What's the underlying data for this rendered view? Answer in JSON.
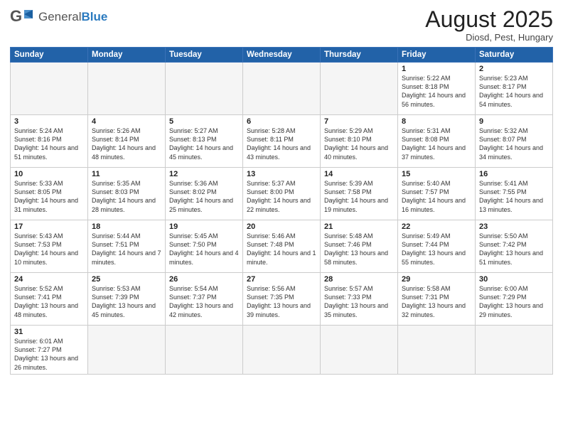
{
  "header": {
    "logo_general": "General",
    "logo_blue": "Blue",
    "month_title": "August 2025",
    "location": "Diosd, Pest, Hungary"
  },
  "weekdays": [
    "Sunday",
    "Monday",
    "Tuesday",
    "Wednesday",
    "Thursday",
    "Friday",
    "Saturday"
  ],
  "weeks": [
    [
      {
        "day": "",
        "info": ""
      },
      {
        "day": "",
        "info": ""
      },
      {
        "day": "",
        "info": ""
      },
      {
        "day": "",
        "info": ""
      },
      {
        "day": "",
        "info": ""
      },
      {
        "day": "1",
        "info": "Sunrise: 5:22 AM\nSunset: 8:18 PM\nDaylight: 14 hours and 56 minutes."
      },
      {
        "day": "2",
        "info": "Sunrise: 5:23 AM\nSunset: 8:17 PM\nDaylight: 14 hours and 54 minutes."
      }
    ],
    [
      {
        "day": "3",
        "info": "Sunrise: 5:24 AM\nSunset: 8:16 PM\nDaylight: 14 hours and 51 minutes."
      },
      {
        "day": "4",
        "info": "Sunrise: 5:26 AM\nSunset: 8:14 PM\nDaylight: 14 hours and 48 minutes."
      },
      {
        "day": "5",
        "info": "Sunrise: 5:27 AM\nSunset: 8:13 PM\nDaylight: 14 hours and 45 minutes."
      },
      {
        "day": "6",
        "info": "Sunrise: 5:28 AM\nSunset: 8:11 PM\nDaylight: 14 hours and 43 minutes."
      },
      {
        "day": "7",
        "info": "Sunrise: 5:29 AM\nSunset: 8:10 PM\nDaylight: 14 hours and 40 minutes."
      },
      {
        "day": "8",
        "info": "Sunrise: 5:31 AM\nSunset: 8:08 PM\nDaylight: 14 hours and 37 minutes."
      },
      {
        "day": "9",
        "info": "Sunrise: 5:32 AM\nSunset: 8:07 PM\nDaylight: 14 hours and 34 minutes."
      }
    ],
    [
      {
        "day": "10",
        "info": "Sunrise: 5:33 AM\nSunset: 8:05 PM\nDaylight: 14 hours and 31 minutes."
      },
      {
        "day": "11",
        "info": "Sunrise: 5:35 AM\nSunset: 8:03 PM\nDaylight: 14 hours and 28 minutes."
      },
      {
        "day": "12",
        "info": "Sunrise: 5:36 AM\nSunset: 8:02 PM\nDaylight: 14 hours and 25 minutes."
      },
      {
        "day": "13",
        "info": "Sunrise: 5:37 AM\nSunset: 8:00 PM\nDaylight: 14 hours and 22 minutes."
      },
      {
        "day": "14",
        "info": "Sunrise: 5:39 AM\nSunset: 7:58 PM\nDaylight: 14 hours and 19 minutes."
      },
      {
        "day": "15",
        "info": "Sunrise: 5:40 AM\nSunset: 7:57 PM\nDaylight: 14 hours and 16 minutes."
      },
      {
        "day": "16",
        "info": "Sunrise: 5:41 AM\nSunset: 7:55 PM\nDaylight: 14 hours and 13 minutes."
      }
    ],
    [
      {
        "day": "17",
        "info": "Sunrise: 5:43 AM\nSunset: 7:53 PM\nDaylight: 14 hours and 10 minutes."
      },
      {
        "day": "18",
        "info": "Sunrise: 5:44 AM\nSunset: 7:51 PM\nDaylight: 14 hours and 7 minutes."
      },
      {
        "day": "19",
        "info": "Sunrise: 5:45 AM\nSunset: 7:50 PM\nDaylight: 14 hours and 4 minutes."
      },
      {
        "day": "20",
        "info": "Sunrise: 5:46 AM\nSunset: 7:48 PM\nDaylight: 14 hours and 1 minute."
      },
      {
        "day": "21",
        "info": "Sunrise: 5:48 AM\nSunset: 7:46 PM\nDaylight: 13 hours and 58 minutes."
      },
      {
        "day": "22",
        "info": "Sunrise: 5:49 AM\nSunset: 7:44 PM\nDaylight: 13 hours and 55 minutes."
      },
      {
        "day": "23",
        "info": "Sunrise: 5:50 AM\nSunset: 7:42 PM\nDaylight: 13 hours and 51 minutes."
      }
    ],
    [
      {
        "day": "24",
        "info": "Sunrise: 5:52 AM\nSunset: 7:41 PM\nDaylight: 13 hours and 48 minutes."
      },
      {
        "day": "25",
        "info": "Sunrise: 5:53 AM\nSunset: 7:39 PM\nDaylight: 13 hours and 45 minutes."
      },
      {
        "day": "26",
        "info": "Sunrise: 5:54 AM\nSunset: 7:37 PM\nDaylight: 13 hours and 42 minutes."
      },
      {
        "day": "27",
        "info": "Sunrise: 5:56 AM\nSunset: 7:35 PM\nDaylight: 13 hours and 39 minutes."
      },
      {
        "day": "28",
        "info": "Sunrise: 5:57 AM\nSunset: 7:33 PM\nDaylight: 13 hours and 35 minutes."
      },
      {
        "day": "29",
        "info": "Sunrise: 5:58 AM\nSunset: 7:31 PM\nDaylight: 13 hours and 32 minutes."
      },
      {
        "day": "30",
        "info": "Sunrise: 6:00 AM\nSunset: 7:29 PM\nDaylight: 13 hours and 29 minutes."
      }
    ],
    [
      {
        "day": "31",
        "info": "Sunrise: 6:01 AM\nSunset: 7:27 PM\nDaylight: 13 hours and 26 minutes."
      },
      {
        "day": "",
        "info": ""
      },
      {
        "day": "",
        "info": ""
      },
      {
        "day": "",
        "info": ""
      },
      {
        "day": "",
        "info": ""
      },
      {
        "day": "",
        "info": ""
      },
      {
        "day": "",
        "info": ""
      }
    ]
  ]
}
